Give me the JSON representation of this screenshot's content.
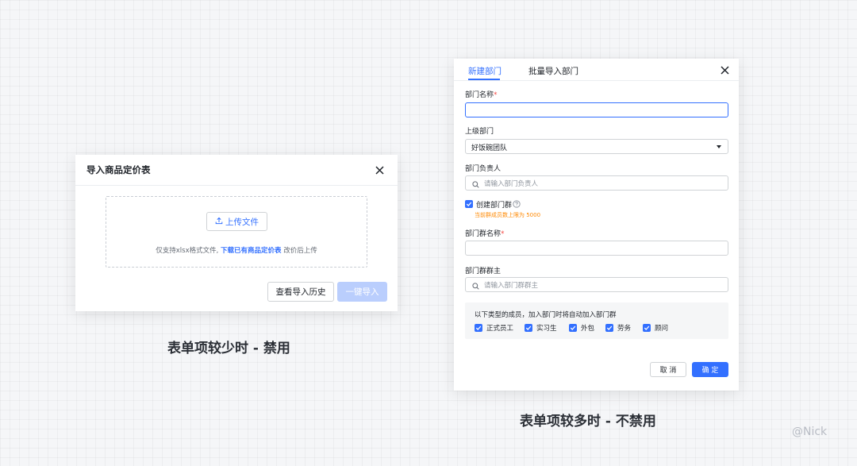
{
  "left_modal": {
    "title": "导入商品定价表",
    "upload_label": "上传文件",
    "note_prefix": "仅支持xlsx格式文件,",
    "note_link": "下载已有商品定价表",
    "note_suffix": "改价后上传",
    "history_button": "查看导入历史",
    "import_button": "一键导入"
  },
  "caption_left": "表单项较少时 - 禁用",
  "right_form": {
    "tabs": [
      "新建部门",
      "批量导入部门"
    ],
    "dept_name_label": "部门名称",
    "parent_label": "上级部门",
    "parent_value": "好饭碗团队",
    "owner_label": "部门负责人",
    "owner_placeholder": "请输入部门负责人",
    "create_group_label": "创建部门群",
    "group_limit_note": "当前群成员数上限为 5000",
    "group_name_label": "部门群名称",
    "group_owner_label": "部门群群主",
    "group_owner_placeholder": "请输入部门群群主",
    "auto_join_title": "以下类型的成员，加入部门时将自动加入部门群",
    "member_types": [
      "正式员工",
      "实习生",
      "外包",
      "劳务",
      "顾问"
    ],
    "cancel_button": "取 消",
    "confirm_button": "确 定",
    "required_mark": "*"
  },
  "caption_right": "表单项较多时 - 不禁用",
  "watermark": "@Nick",
  "colors": {
    "primary": "#3370ff",
    "disabled": "#bacefd",
    "warning": "#ff8800",
    "required": "#f54a45"
  }
}
